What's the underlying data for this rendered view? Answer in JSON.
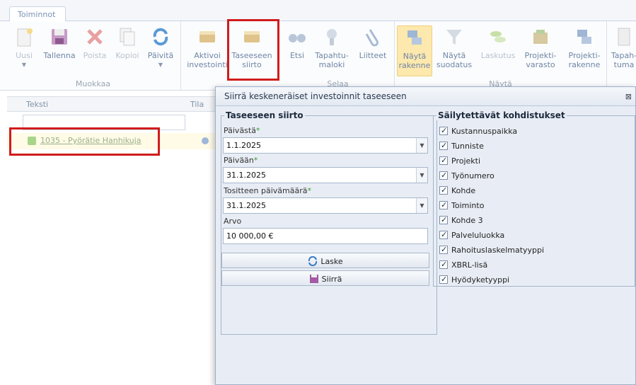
{
  "ribbon_tab": "Toiminnot",
  "groups": {
    "muokkaa": "Muokkaa",
    "selaa": "Selaa",
    "nayta": "Näytä"
  },
  "buttons": {
    "uusi": "Uusi",
    "tallenna": "Tallenna",
    "poista": "Poista",
    "kopioi": "Kopioi",
    "paivita": "Päivitä",
    "aktivoi": "Aktivoi investointi",
    "taseeseen": "Taseeseen siirto",
    "etsi": "Etsi",
    "tapahtumaloki": "Tapahtu-maloki",
    "liitteet": "Liitteet",
    "nayta_rakenne": "Näytä rakenne",
    "nayta_suodatus": "Näytä suodatus",
    "laskutus": "Laskutus",
    "projektivarasto": "Projekti-varasto",
    "projektirakenne": "Projekti-rakenne",
    "tapahtumat": "Tapah-tuma"
  },
  "grid": {
    "col_teksti": "Teksti",
    "col_tila": "Tila",
    "row_text": "1035 - Pyörätie Hanhikuja"
  },
  "dialog": {
    "title": "Siirrä keskeneräiset investoinnit taseeseen",
    "close": "⊠",
    "left_legend": "Taseeseen siirto",
    "paivasta_label": "Päivästä",
    "paivasta_value": "1.1.2025",
    "paivaan_label": "Päivään",
    "paivaan_value": "31.1.2025",
    "tosite_label": "Tositteen päivämäärä",
    "tosite_value": "31.1.2025",
    "arvo_label": "Arvo",
    "arvo_value": "10 000,00 €",
    "required_mark": "*",
    "laske": "Laske",
    "siirra": "Siirrä",
    "right_legend": "Säilytettävät kohdistukset",
    "checkboxes": [
      "Kustannuspaikka",
      "Tunniste",
      "Projekti",
      "Työnumero",
      "Kohde",
      "Toiminto",
      "Kohde 3",
      "Palveluluokka",
      "Rahoituslaskelmatyyppi",
      "XBRL-lisä",
      "Hyödyketyyppi"
    ]
  }
}
